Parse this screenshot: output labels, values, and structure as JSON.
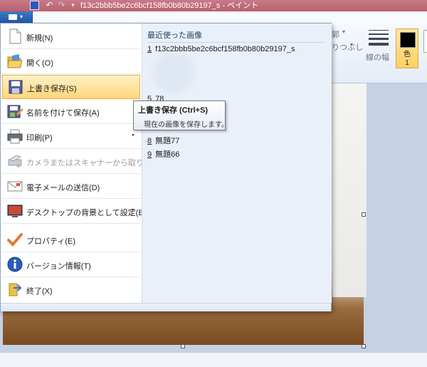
{
  "window": {
    "title": "f13c2bbb5be2c6bcf158fb0b80b29197_s - ペイント"
  },
  "quick_access": {
    "undo_glyph": "↶",
    "redo_glyph": "↷",
    "customize_glyph": "▾",
    "icons": [
      "save-icon",
      "undo-icon",
      "redo-icon",
      "customize-arrow-icon"
    ]
  },
  "app_menu_button": {
    "arrow_glyph": "▾"
  },
  "ribbon": {
    "partial_label_1": "線の幅",
    "color_label_line1": "色",
    "color_label_line2": "1",
    "fragments": [
      "郭",
      "りつぶし",
      "▾",
      "▾"
    ],
    "colors": {
      "accent_hot": "#ffd061",
      "color1": "#000000"
    }
  },
  "menu": {
    "items": [
      {
        "label": "新規(N)",
        "icon": "new-document-icon"
      },
      {
        "label": "開く(O)",
        "icon": "open-folder-icon"
      },
      {
        "label": "上書き保存(S)",
        "icon": "save-icon"
      },
      {
        "label": "名前を付けて保存(A)",
        "icon": "save-as-icon"
      },
      {
        "label": "印刷(P)",
        "icon": "printer-icon"
      },
      {
        "label": "カメラまたはスキャナーから取り込み(M)",
        "icon": "scanner-icon"
      },
      {
        "label": "電子メールの送信(D)",
        "icon": "email-icon"
      },
      {
        "label": "デスクトップの背景として設定(B)",
        "icon": "desktop-background-icon"
      },
      {
        "label": "プロパティ(E)",
        "icon": "properties-check-icon"
      },
      {
        "label": "バージョン情報(T)",
        "icon": "info-icon"
      },
      {
        "label": "終了(X)",
        "icon": "exit-icon"
      }
    ],
    "submenu_arrow_glyph": "▸"
  },
  "recent": {
    "title": "最近使った画像",
    "items": [
      {
        "num": "1",
        "name": "f13c2bbb5be2c6bcf158fb0b80b29197_s"
      },
      {
        "num": "5",
        "name": "78"
      },
      {
        "num": "8",
        "name": "無題77"
      },
      {
        "num": "9",
        "name": "無題66"
      }
    ]
  },
  "tooltip": {
    "title": "上書き保存 (Ctrl+S)",
    "body": "現在の画像を保存します。"
  }
}
